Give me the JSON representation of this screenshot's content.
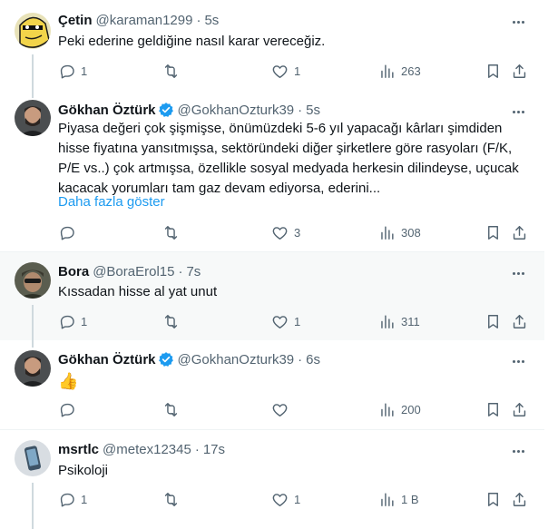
{
  "tweets": [
    {
      "name": "Çetin",
      "handle": "@karaman1299",
      "dot": "·",
      "time": "5s",
      "verified": false,
      "text": "Peki ederine geldiğine nasıl karar vereceğiz.",
      "replies": "1",
      "retweets": "",
      "likes": "1",
      "views": "263"
    },
    {
      "name": "Gökhan Öztürk",
      "handle": "@GokhanOzturk39",
      "dot": "·",
      "time": "5s",
      "verified": true,
      "text_lines": [
        "Piyasa değeri çok şişmişse, önümüzdeki 5-6 yıl yapacağı kârları şimdiden",
        "hisse fiyatına yansıtmışsa, sektöründeki diğer şirketlere göre rasyoları (F/K,",
        "P/E vs..) çok artmışsa, özellikle sosyal medyada herkesin dilindeyse, uçucak",
        "kacacak yorumları tam gaz devam ediyorsa, ederini..."
      ],
      "show_more": "Daha fazla göster",
      "replies": "",
      "retweets": "",
      "likes": "3",
      "views": "308"
    },
    {
      "name": "Bora",
      "handle": "@BoraErol15",
      "dot": "·",
      "time": "7s",
      "verified": false,
      "text": "Kıssadan hisse al yat unut",
      "replies": "1",
      "retweets": "",
      "likes": "1",
      "views": "311"
    },
    {
      "name": "Gökhan Öztürk",
      "handle": "@GokhanOzturk39",
      "dot": "·",
      "time": "6s",
      "verified": true,
      "text": "👍",
      "replies": "",
      "retweets": "",
      "likes": "",
      "views": "200"
    },
    {
      "name": "msrtlc",
      "handle": "@metex12345",
      "dot": "·",
      "time": "17s",
      "verified": false,
      "text": "Psikoloji",
      "replies": "1",
      "retweets": "",
      "likes": "1",
      "views": "1 B"
    }
  ],
  "colors": {
    "accent": "#1d9bf0",
    "muted": "#536471",
    "highlight_bg": "#f7f9f9",
    "thread_line": "#cfd9de"
  },
  "icons": [
    "reply-icon",
    "retweet-icon",
    "like-icon",
    "views-icon",
    "bookmark-icon",
    "share-icon",
    "verified-icon",
    "more-icon"
  ]
}
